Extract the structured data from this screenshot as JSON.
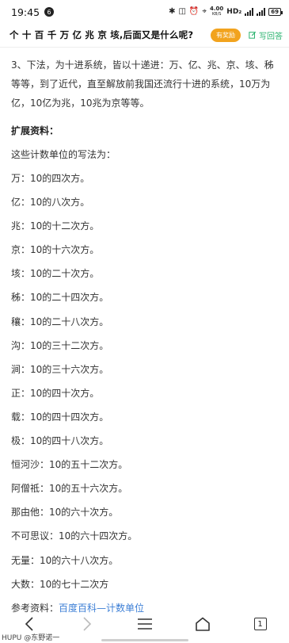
{
  "status_bar": {
    "time": "19:45",
    "notification_count": "6",
    "net_speed": "4.00",
    "net_unit": "KB/S",
    "hd_label": "HD₂",
    "battery": "69"
  },
  "question": {
    "title": "个 十 百 千 万 亿 兆 京 垓,后面又是什么呢?",
    "reward_label": "有奖励",
    "write_answer_label": "写回答"
  },
  "article": {
    "intro": "3、下法，为十进系统，皆以十递进：万、亿、兆、京、垓、秭等等，到了近代，直至解放前我国还流行十进的系统，10万为亿，10亿为兆，10兆为京等等。",
    "extended_heading": "扩展资料：",
    "list_intro": "这些计数单位的写法为：",
    "units": [
      "万：10的四次方。",
      "亿：10的八次方。",
      "兆：10的十二次方。",
      "京：10的十六次方。",
      "垓：10的二十次方。",
      "秭：10的二十四次方。",
      "穰：10的二十八次方。",
      "沟：10的三十二次方。",
      "涧：10的三十六次方。",
      "正：10的四十次方。",
      "载：10的四十四次方。",
      "极：10的四十八次方。",
      "恒河沙：10的五十二次方。",
      "阿僧祗：10的五十六次方。",
      "那由他：10的六十次方。",
      "不可思议：10的六十四次方。",
      "无量：10的六十八次方。",
      "大数：10的七十二次方"
    ],
    "reference_label": "参考资料：",
    "reference_link": "百度百科—计数单位"
  },
  "bottom_nav": {
    "tab_count": "1"
  },
  "watermark": "HUPU @东野诺一"
}
